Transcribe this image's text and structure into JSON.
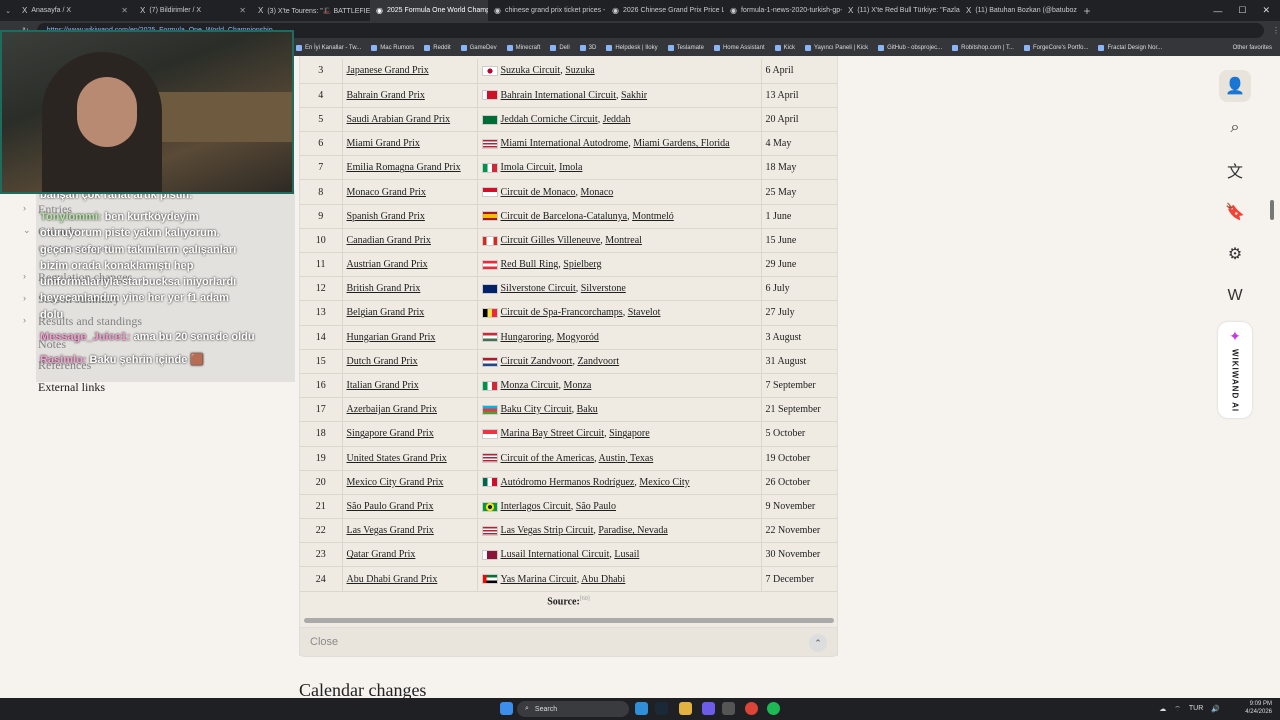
{
  "browser": {
    "tabs": [
      {
        "label": "Anasayfa / X",
        "icon": "x-icon",
        "active": false
      },
      {
        "label": "(7) Bildirimler / X",
        "icon": "x-icon",
        "active": false
      },
      {
        "label": "(3) X'te Tourens: \"🎩 BATTLEFIELD",
        "icon": "x-icon",
        "active": false
      },
      {
        "label": "2025 Formula One World Champ",
        "icon": "wikiwand-icon",
        "active": true
      },
      {
        "label": "chinese grand prix ticket prices -",
        "icon": "google-icon",
        "active": false
      },
      {
        "label": "2026 Chinese Grand Prix Price Lis",
        "icon": "page-icon",
        "active": false
      },
      {
        "label": "formula-1-news-2020-turkish-gp-",
        "icon": "globe-icon",
        "active": false
      },
      {
        "label": "(11) X'te Red Bull Türkiye: \"Fazla H",
        "icon": "x-icon",
        "active": false
      },
      {
        "label": "(11) Batuhan Bozkan (@batuboz",
        "icon": "x-icon",
        "active": false
      }
    ],
    "url": "https://www.wikiwand.com/en/2025_Formula_One_World_Championship",
    "bookmarks": [
      "En İyi Kanallar - Tw...",
      "Mac Rumors",
      "Reddit",
      "GameDev",
      "Minecraft",
      "Dell",
      "3D",
      "Helpdesk | Iloky",
      "Teslamate",
      "Home Assistant",
      "Kick",
      "Yayıncı Paneli | Kick",
      "GitHub - obsprojec...",
      "Robitshop.com | T...",
      "ForgeCore's Portfo...",
      "Fractal Design Nor..."
    ],
    "other_bookmarks": "Other favorites"
  },
  "stream_chat": [
    {
      "user": "",
      "text": "bahşan çok rahat artık pistin."
    },
    {
      "user": "Tonylommi:",
      "text": "ben kurtköydeyim"
    },
    {
      "user": "",
      "text": "oturuyorum piste yakın kalıyorum."
    },
    {
      "user": "",
      "text": "geçen sefer tüm takımların çalışanları"
    },
    {
      "user": "",
      "text": "bizim orada konaklamıştı hep"
    },
    {
      "user": "",
      "text": "uniformalarıyla starbucksa iniyorlardı"
    },
    {
      "user": "",
      "text": "heyecanlandım yine her yer f1 adam"
    },
    {
      "user": "",
      "text": "dolu"
    },
    {
      "user": "Message_Juice1:",
      "text": "ama bu 20 senede oldu"
    },
    {
      "user": "Rasimlo:",
      "text": "Baku şehrin içinde 🟫"
    }
  ],
  "toc": {
    "items": [
      {
        "label": "Entries",
        "chev": "›"
      },
      {
        "label": "Calendar",
        "chev": "⌄"
      },
      {
        "label": "Calendar changes",
        "chev": ""
      },
      {
        "label": "Regulation changes",
        "chev": "›"
      },
      {
        "label": "Season summary",
        "chev": "›"
      },
      {
        "label": "Results and standings",
        "chev": "›"
      },
      {
        "label": "Notes",
        "chev": ""
      },
      {
        "label": "References",
        "chev": ""
      },
      {
        "label": "External links",
        "chev": ""
      }
    ]
  },
  "calendar": {
    "rows": [
      {
        "round": "3",
        "gp": "Japanese Grand Prix",
        "circuit": "Suzuka Circuit",
        "city": "Suzuka",
        "date": "6 April",
        "flag": "japan-flag-icon"
      },
      {
        "round": "4",
        "gp": "Bahrain Grand Prix",
        "circuit": "Bahrain International Circuit",
        "city": "Sakhir",
        "date": "13 April",
        "flag": "bahrain-flag-icon"
      },
      {
        "round": "5",
        "gp": "Saudi Arabian Grand Prix",
        "circuit": "Jeddah Corniche Circuit",
        "city": "Jeddah",
        "date": "20 April",
        "flag": "saudi-flag-icon"
      },
      {
        "round": "6",
        "gp": "Miami Grand Prix",
        "circuit": "Miami International Autodrome",
        "city": "Miami Gardens, Florida",
        "date": "4 May",
        "flag": "usa-flag-icon"
      },
      {
        "round": "7",
        "gp": "Emilia Romagna Grand Prix",
        "circuit": "Imola Circuit",
        "city": "Imola",
        "date": "18 May",
        "flag": "italy-flag-icon"
      },
      {
        "round": "8",
        "gp": "Monaco Grand Prix",
        "circuit": "Circuit de Monaco",
        "city": "Monaco",
        "date": "25 May",
        "flag": "monaco-flag-icon"
      },
      {
        "round": "9",
        "gp": "Spanish Grand Prix",
        "circuit": "Circuit de Barcelona-Catalunya",
        "city": "Montmeló",
        "date": "1 June",
        "flag": "spain-flag-icon"
      },
      {
        "round": "10",
        "gp": "Canadian Grand Prix",
        "circuit": "Circuit Gilles Villeneuve",
        "city": "Montreal",
        "date": "15 June",
        "flag": "canada-flag-icon"
      },
      {
        "round": "11",
        "gp": "Austrian Grand Prix",
        "circuit": "Red Bull Ring",
        "city": "Spielberg",
        "date": "29 June",
        "flag": "austria-flag-icon"
      },
      {
        "round": "12",
        "gp": "British Grand Prix",
        "circuit": "Silverstone Circuit",
        "city": "Silverstone",
        "date": "6 July",
        "flag": "uk-flag-icon"
      },
      {
        "round": "13",
        "gp": "Belgian Grand Prix",
        "circuit": "Circuit de Spa-Francorchamps",
        "city": "Stavelot",
        "date": "27 July",
        "flag": "belgium-flag-icon"
      },
      {
        "round": "14",
        "gp": "Hungarian Grand Prix",
        "circuit": "Hungaroring",
        "city": "Mogyoród",
        "date": "3 August",
        "flag": "hungary-flag-icon"
      },
      {
        "round": "15",
        "gp": "Dutch Grand Prix",
        "circuit": "Circuit Zandvoort",
        "city": "Zandvoort",
        "date": "31 August",
        "flag": "netherlands-flag-icon"
      },
      {
        "round": "16",
        "gp": "Italian Grand Prix",
        "circuit": "Monza Circuit",
        "city": "Monza",
        "date": "7 September",
        "flag": "italy-flag-icon"
      },
      {
        "round": "17",
        "gp": "Azerbaijan Grand Prix",
        "circuit": "Baku City Circuit",
        "city": "Baku",
        "date": "21 September",
        "flag": "azerbaijan-flag-icon"
      },
      {
        "round": "18",
        "gp": "Singapore Grand Prix",
        "circuit": "Marina Bay Street Circuit",
        "city": "Singapore",
        "date": "5 October",
        "flag": "singapore-flag-icon"
      },
      {
        "round": "19",
        "gp": "United States Grand Prix",
        "circuit": "Circuit of the Americas",
        "city": "Austin, Texas",
        "date": "19 October",
        "flag": "usa-flag-icon"
      },
      {
        "round": "20",
        "gp": "Mexico City Grand Prix",
        "circuit": "Autódromo Hermanos Rodríguez",
        "city": "Mexico City",
        "date": "26 October",
        "flag": "mexico-flag-icon"
      },
      {
        "round": "21",
        "gp": "São Paulo Grand Prix",
        "circuit": "Interlagos Circuit",
        "city": "São Paulo",
        "date": "9 November",
        "flag": "brazil-flag-icon"
      },
      {
        "round": "22",
        "gp": "Las Vegas Grand Prix",
        "circuit": "Las Vegas Strip Circuit",
        "city": "Paradise, Nevada",
        "date": "22 November",
        "flag": "usa-flag-icon"
      },
      {
        "round": "23",
        "gp": "Qatar Grand Prix",
        "circuit": "Lusail International Circuit",
        "city": "Lusail",
        "date": "30 November",
        "flag": "qatar-flag-icon"
      },
      {
        "round": "24",
        "gp": "Abu Dhabi Grand Prix",
        "circuit": "Yas Marina Circuit",
        "city": "Abu Dhabi",
        "date": "7 December",
        "flag": "uae-flag-icon"
      }
    ],
    "source_label": "Source:",
    "close_label": "Close"
  },
  "next_heading": "Calendar changes",
  "right_rail": {
    "ai_label": "WIKIWAND AI"
  },
  "taskbar": {
    "search_placeholder": "Search",
    "lang": "TUR",
    "time": "9:09 PM",
    "date": "4/24/2026"
  },
  "colors": {
    "accent": "#c43ae0",
    "tab_bg": "#202124",
    "page_bg": "#f6f3ee",
    "table_bg": "#efebe3"
  }
}
